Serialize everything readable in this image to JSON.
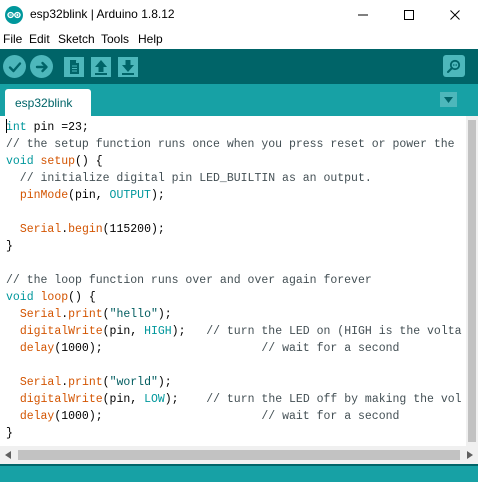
{
  "window": {
    "title": "esp32blink | Arduino 1.8.12",
    "app_icon": "arduino-logo-icon",
    "controls": [
      "minimize-icon",
      "maximize-icon",
      "close-icon"
    ]
  },
  "menu": {
    "file": "File",
    "edit": "Edit",
    "sketch": "Sketch",
    "tools": "Tools",
    "help": "Help"
  },
  "toolbar": {
    "buttons": [
      "verify-icon",
      "upload-icon",
      "new-icon",
      "open-icon",
      "save-icon",
      "serial-monitor-icon"
    ]
  },
  "tabs": [
    {
      "label": "esp32blink",
      "active": true
    }
  ],
  "editor": {
    "lines": [
      "int pin =23;",
      "// the setup function runs once when you press reset or power the",
      "void setup() {",
      "  // initialize digital pin LED_BUILTIN as an output.",
      "  pinMode(pin, OUTPUT);",
      "",
      "  Serial.begin(115200);",
      "}",
      "",
      "// the loop function runs over and over again forever",
      "void loop() {",
      "  Serial.print(\"hello\");",
      "  digitalWrite(pin, HIGH);   // turn the LED on (HIGH is the volta",
      "  delay(1000);                       // wait for a second",
      "",
      "  Serial.print(\"world\");",
      "  digitalWrite(pin, LOW);    // turn the LED off by making the vol",
      "  delay(1000);                       // wait for a second",
      "}"
    ]
  },
  "colors": {
    "toolbar": "#006468",
    "tabstrip": "#17a1a5",
    "button": "#4db7bb",
    "keyword": "#00979c",
    "function": "#d35400",
    "comment": "#434f54",
    "string": "#005c5f"
  }
}
